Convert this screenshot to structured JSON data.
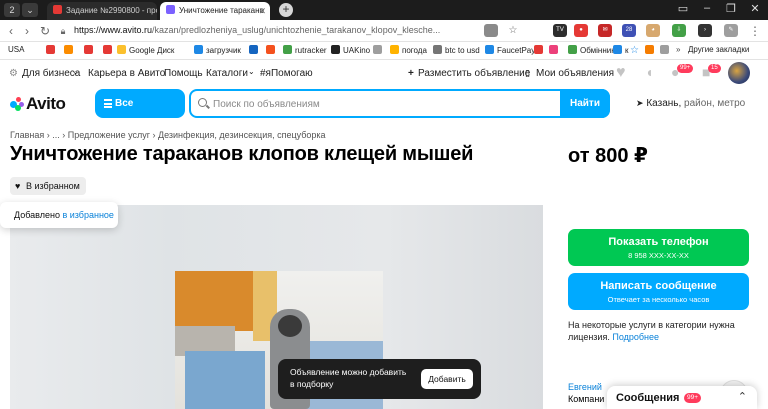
{
  "browser": {
    "tab_counter": "2",
    "tabs": [
      {
        "label": "Задание №2990800 - про",
        "fav_color": "#e53935",
        "fav_text": "$P"
      },
      {
        "label": "Уничтожение таракано",
        "fav_color": "#7b61ff"
      }
    ],
    "address": {
      "host": "https://www.avito.ru",
      "path": "/kazan/predlozheniya_uslug/unichtozhenie_tarakanov_klopov_klesche..."
    },
    "extensions": [
      {
        "name": "reader-icon",
        "color": "#8a8a8a",
        "text": ""
      },
      {
        "name": "tv-extension-icon",
        "color": "#2d2d2d",
        "text": "TV"
      },
      {
        "name": "red-extension-icon",
        "color": "#e53935",
        "text": "●"
      },
      {
        "name": "mail-extension-icon",
        "color": "#c62828",
        "text": "✉"
      },
      {
        "name": "counter-extension-icon",
        "color": "#3f51b5",
        "text": "28"
      },
      {
        "name": "owl-extension-icon",
        "color": "#d7a86e",
        "text": "◕"
      },
      {
        "name": "download-extension-icon",
        "color": "#43a047",
        "text": "⇩"
      },
      {
        "name": "arrow-extension-icon",
        "color": "#333",
        "text": "›"
      },
      {
        "name": "pen-extension-icon",
        "color": "#9e9e9e",
        "text": "✎"
      }
    ],
    "bookmarks": [
      {
        "label": "USA",
        "color": "#1e88e5"
      },
      {
        "label": "",
        "color": "#e53935"
      },
      {
        "label": "",
        "color": "#fb8c00"
      },
      {
        "label": "",
        "color": "#e53935"
      },
      {
        "label": "Google Диск",
        "color": "#fbc02d"
      },
      {
        "label": "загрузчик",
        "color": "#1e88e5"
      },
      {
        "label": "",
        "color": "#1565c0"
      },
      {
        "label": "",
        "color": "#f4511e"
      },
      {
        "label": "rutracker",
        "color": "#43a047"
      },
      {
        "label": "UAKino",
        "color": "#222"
      },
      {
        "label": "погода",
        "color": "#ffb300"
      },
      {
        "label": "btc to usd",
        "color": "#757575"
      },
      {
        "label": "FaucetPay",
        "color": "#1e88e5"
      },
      {
        "label": "",
        "color": "#e53935"
      },
      {
        "label": "Обмінник",
        "color": "#43a047"
      },
      {
        "label": "к",
        "color": "#1e88e5"
      },
      {
        "label": "Другие закладки",
        "color": "#fbc02d"
      }
    ]
  },
  "topnav": {
    "business": "Для бизнеса",
    "career": "Карьера в Авито",
    "help": "Помощь",
    "catalogs": "Каталоги",
    "pomogayu": "#яПомогаю",
    "post_ad": "Разместить объявление",
    "my_ads": "Мои объявления",
    "messages_badge": "99+",
    "cart_badge": "15"
  },
  "header": {
    "logo": "Avito",
    "categories_label": "Все категории",
    "search_placeholder": "Поиск по объявлениям",
    "search_button": "Найти",
    "location_city": "Казань,",
    "location_rest": " район, метро"
  },
  "listing": {
    "breadcrumbs": "Главная  ›  ...  ›  Предложение услуг  ›  Дезинфекция, дезинсекция, спецуборка",
    "title": "Уничтожение тараканов клопов клещей мышей",
    "price": "от 800 ₽",
    "favorite_button": "В избранном",
    "favorite_toast_prefix": "Добавлено ",
    "favorite_toast_link": "в избранное",
    "collection_tip_line1": "Объявление можно добавить",
    "collection_tip_line2": "в подборку",
    "collection_tip_button": "Добавить"
  },
  "contact": {
    "phone_button": "Показать телефон",
    "phone_sub": "8 958 XXX-XX-XX",
    "message_button": "Написать сообщение",
    "message_sub": "Отвечает за несколько часов",
    "license_text": "На некоторые услуги в категории нужна лицензия. ",
    "license_link": "Подробнее",
    "seller_name": "Евгений",
    "seller_type": "Компани",
    "messages_panel": "Сообщения",
    "messages_panel_badge": "99+"
  },
  "colors": {
    "avito_blue": "#00aaff",
    "avito_green": "#00c853",
    "link_blue": "#0a82d9"
  }
}
